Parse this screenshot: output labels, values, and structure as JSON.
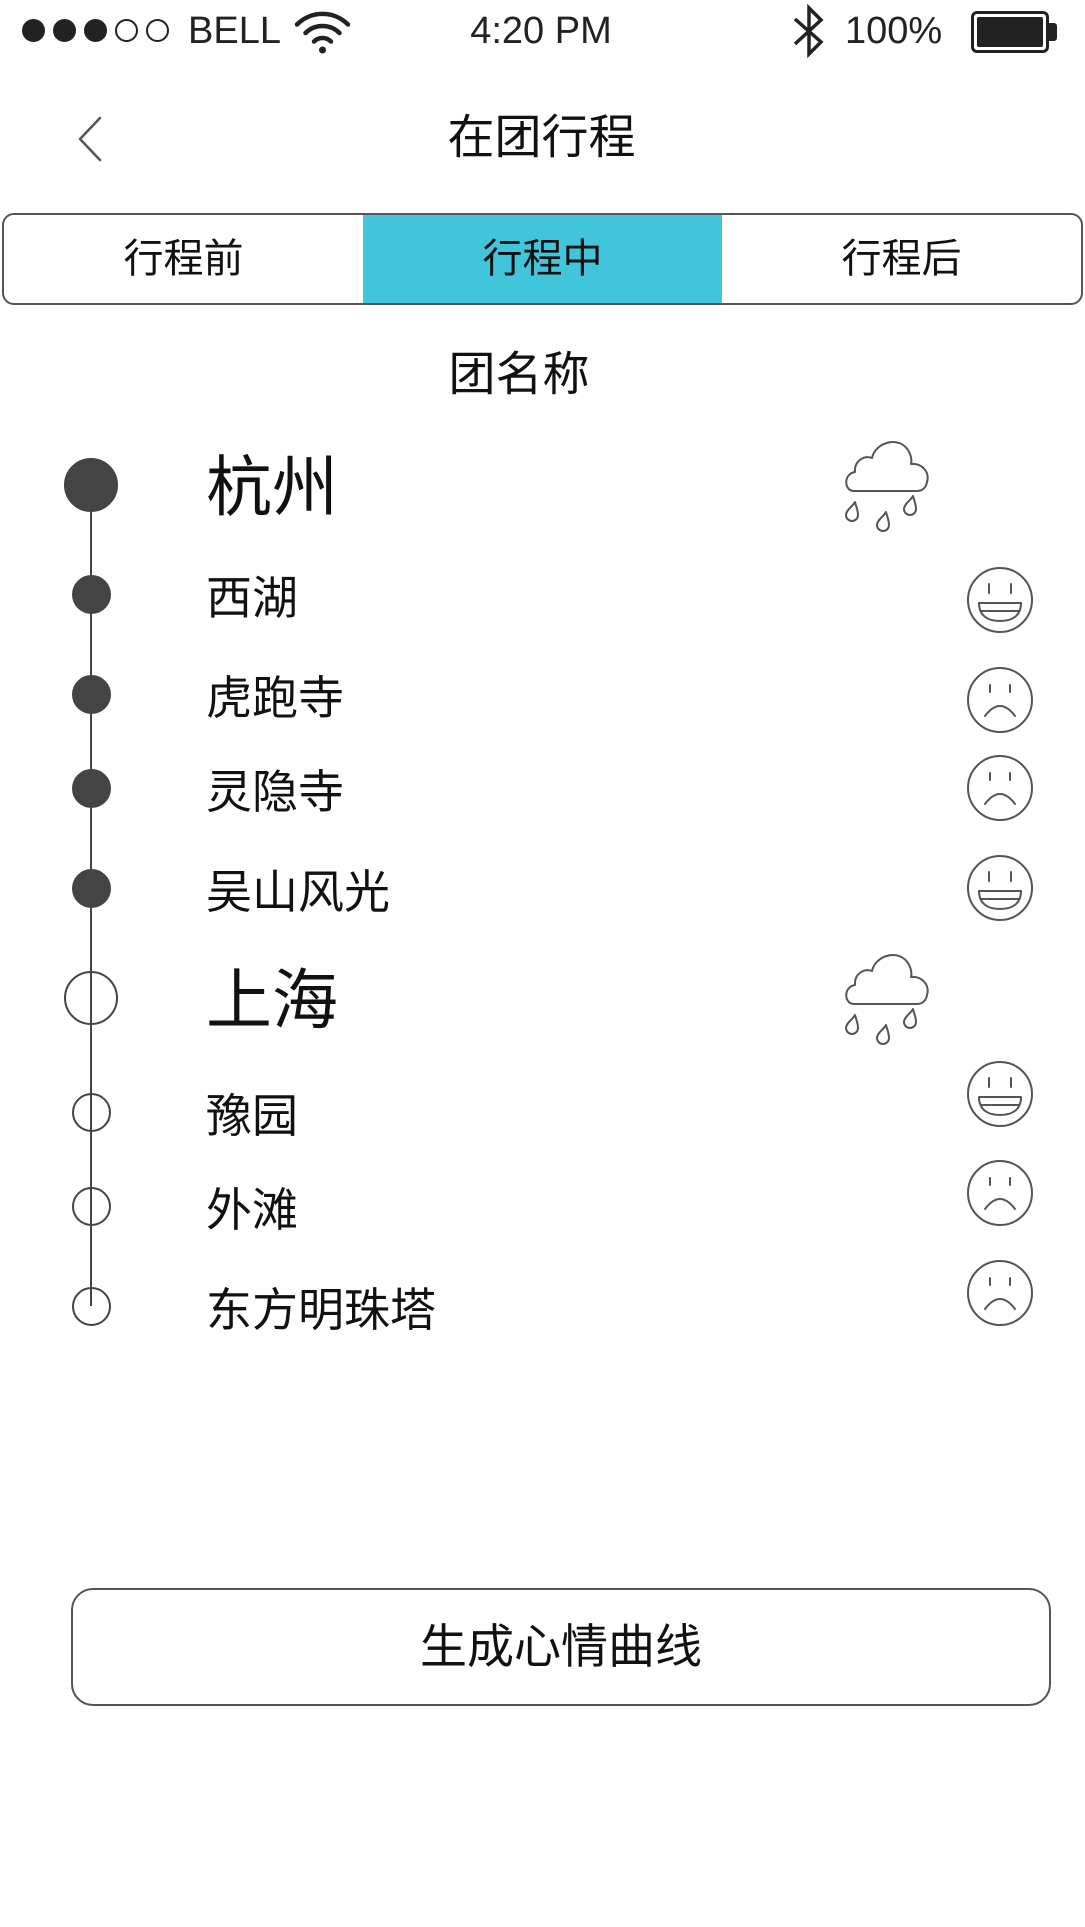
{
  "status_bar": {
    "signal_filled": 3,
    "signal_total": 5,
    "carrier": "BELL",
    "wifi_icon": "wifi-icon",
    "time": "4:20 PM",
    "bluetooth_icon": "bluetooth-icon",
    "battery_label": "100%",
    "battery_level": 1.0
  },
  "header": {
    "back_icon": "chevron-left-icon",
    "title": "在团行程"
  },
  "tabs": {
    "active_index": 1,
    "items": [
      {
        "label": "行程前"
      },
      {
        "label": "行程中"
      },
      {
        "label": "行程后"
      }
    ]
  },
  "group_name": "团名称",
  "itinerary": [
    {
      "city": "杭州",
      "completed": true,
      "weather_icon": "rain-cloud-icon",
      "spots": [
        {
          "name": "西湖",
          "completed": true,
          "mood_icon": "happy-face-icon"
        },
        {
          "name": "虎跑寺",
          "completed": true,
          "mood_icon": "sad-face-icon"
        },
        {
          "name": "灵隐寺",
          "completed": true,
          "mood_icon": "sad-face-icon"
        },
        {
          "name": "吴山风光",
          "completed": true,
          "mood_icon": "happy-face-icon"
        }
      ]
    },
    {
      "city": "上海",
      "completed": false,
      "weather_icon": "rain-cloud-icon",
      "spots": [
        {
          "name": "豫园",
          "completed": false,
          "mood_icon": "happy-face-icon"
        },
        {
          "name": "外滩",
          "completed": false,
          "mood_icon": "sad-face-icon"
        },
        {
          "name": "东方明珠塔",
          "completed": false,
          "mood_icon": "sad-face-icon"
        }
      ]
    }
  ],
  "actions": {
    "mood_curve_button_label": "生成心情曲线"
  },
  "colors": {
    "accent": "#41C5DB",
    "ink": "#111111",
    "node": "#444444",
    "stroke": "#555555"
  }
}
